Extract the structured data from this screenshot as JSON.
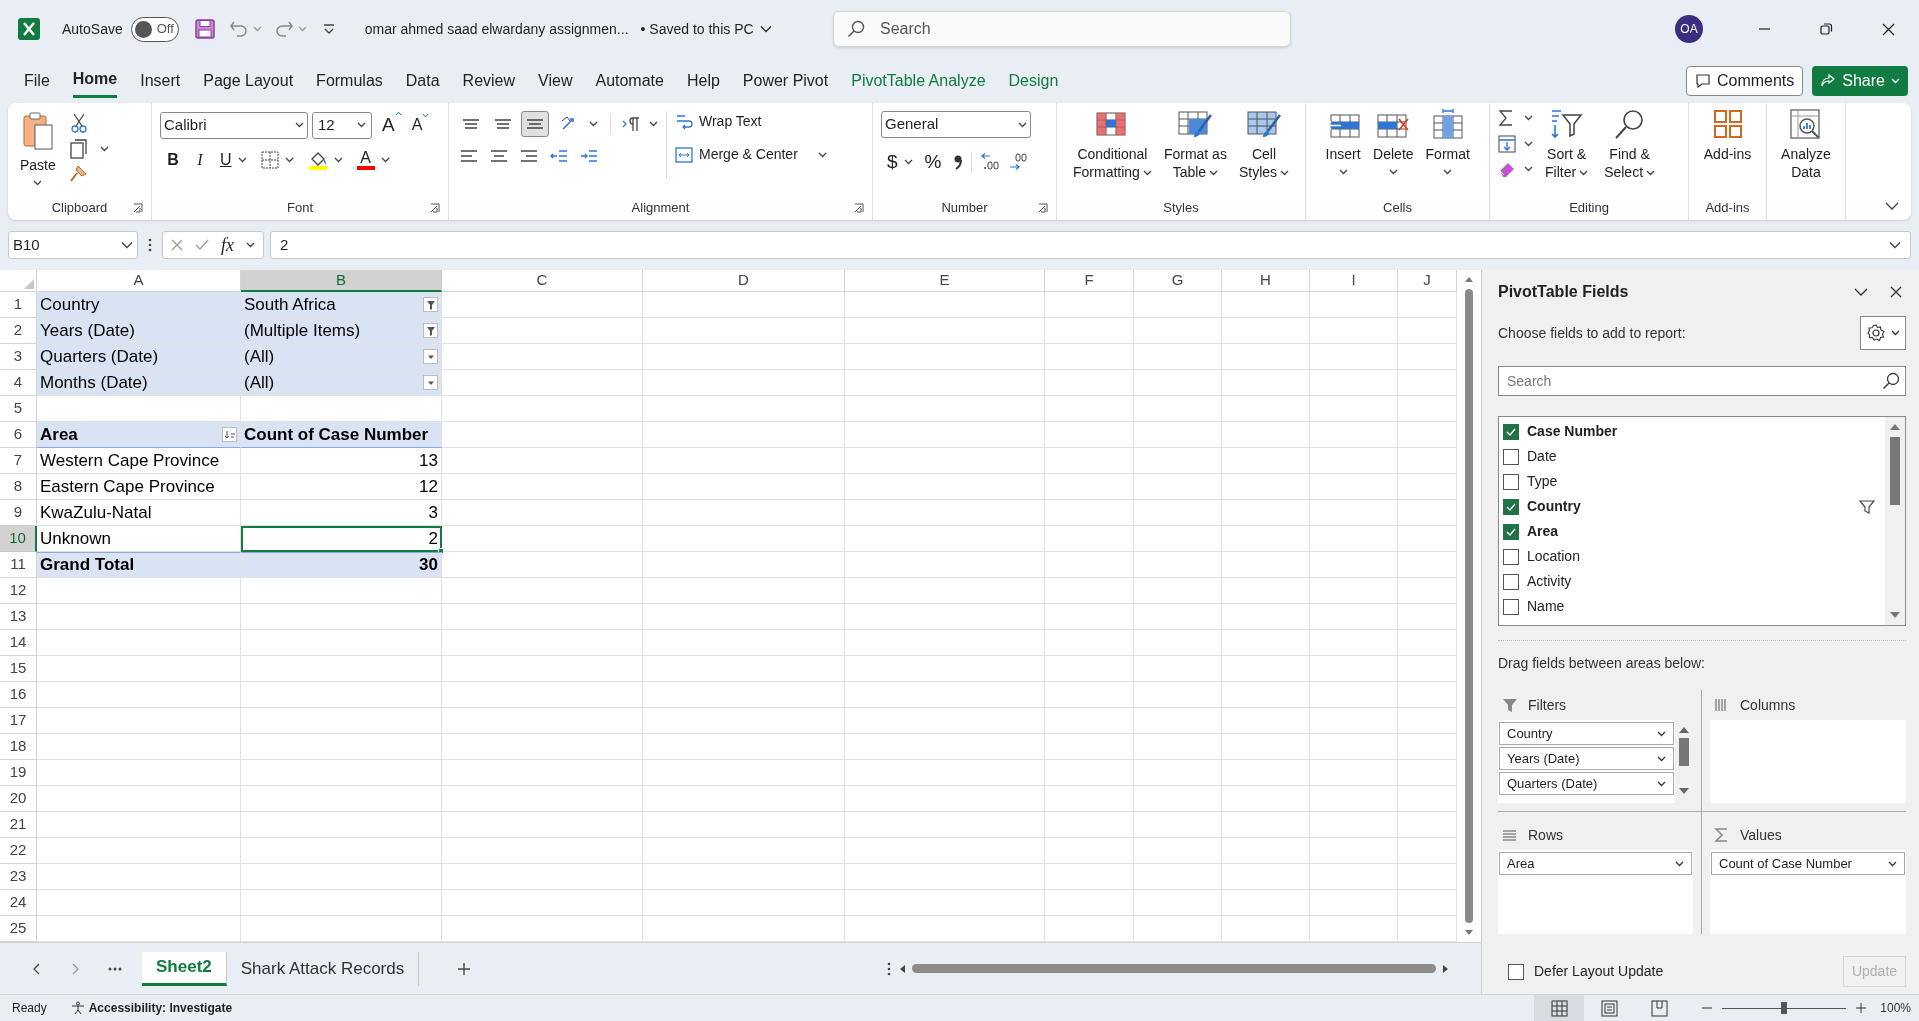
{
  "title_bar": {
    "autosave_label": "AutoSave",
    "autosave_on": false,
    "autosave_state": "Off",
    "document_title": "omar ahmed saad elwardany assignmen...",
    "save_status": "• Saved to this PC",
    "search_placeholder": "Search",
    "avatar": "OA"
  },
  "ribbon_tabs": [
    {
      "label": "File",
      "selected": false,
      "contextual": false
    },
    {
      "label": "Home",
      "selected": true,
      "contextual": false
    },
    {
      "label": "Insert",
      "selected": false,
      "contextual": false
    },
    {
      "label": "Page Layout",
      "selected": false,
      "contextual": false
    },
    {
      "label": "Formulas",
      "selected": false,
      "contextual": false
    },
    {
      "label": "Data",
      "selected": false,
      "contextual": false
    },
    {
      "label": "Review",
      "selected": false,
      "contextual": false
    },
    {
      "label": "View",
      "selected": false,
      "contextual": false
    },
    {
      "label": "Automate",
      "selected": false,
      "contextual": false
    },
    {
      "label": "Help",
      "selected": false,
      "contextual": false
    },
    {
      "label": "Power Pivot",
      "selected": false,
      "contextual": false
    },
    {
      "label": "PivotTable Analyze",
      "selected": false,
      "contextual": true
    },
    {
      "label": "Design",
      "selected": false,
      "contextual": true
    }
  ],
  "comments_button": "Comments",
  "share_button": "Share",
  "ribbon_groups": [
    {
      "kind": "clipboard",
      "label": "Clipboard",
      "launcher": true,
      "paste": "Paste"
    },
    {
      "kind": "font",
      "label": "Font",
      "launcher": true,
      "font_name": "Calibri",
      "font_size": "12",
      "grow_font": "A",
      "shrink_font": "A",
      "bold": "B",
      "italic": "I",
      "underline": "U",
      "font_color": "A"
    },
    {
      "kind": "alignment",
      "label": "Alignment",
      "launcher": true,
      "vertical_align": [
        {
          "selected": false
        },
        {
          "selected": false
        },
        {
          "selected": true
        }
      ],
      "wrap": "Wrap Text",
      "merge": "Merge & Center"
    },
    {
      "kind": "number",
      "label": "Number",
      "launcher": true,
      "format": "General",
      "currency": "$",
      "percent": "%"
    },
    {
      "kind": "styles",
      "label": "Styles",
      "launcher": false,
      "buttons": [
        {
          "kind": "conditional",
          "lines": [
            "Conditional",
            "Formatting"
          ],
          "dropdown": true
        },
        {
          "kind": "tablestyle",
          "lines": [
            "Format as",
            "Table"
          ],
          "dropdown": true
        },
        {
          "kind": "cellstyles",
          "lines": [
            "Cell",
            "Styles"
          ],
          "dropdown": true
        }
      ]
    },
    {
      "kind": "cells",
      "label": "Cells",
      "launcher": false,
      "buttons": [
        {
          "kind": "insert",
          "lines": [
            "Insert"
          ],
          "dropdown": true
        },
        {
          "kind": "delete",
          "lines": [
            "Delete"
          ],
          "dropdown": true
        },
        {
          "kind": "format",
          "lines": [
            "Format"
          ],
          "dropdown": true
        }
      ]
    },
    {
      "kind": "editing",
      "label": "Editing",
      "launcher": false,
      "buttons": [
        {
          "kind": "sort",
          "lines": [
            "Sort &",
            "Filter"
          ],
          "dropdown": true
        },
        {
          "kind": "find",
          "lines": [
            "Find &",
            "Select"
          ],
          "dropdown": true
        }
      ]
    },
    {
      "kind": "addins",
      "label": "Add-ins",
      "launcher": false,
      "buttons": [
        {
          "kind": "addins",
          "lines": [
            "Add-ins"
          ],
          "dropdown": false
        }
      ]
    },
    {
      "kind": "analyze",
      "launcher": false,
      "buttons": [
        {
          "kind": "analyze",
          "lines": [
            "Analyze",
            "Data"
          ],
          "dropdown": false
        }
      ]
    }
  ],
  "formula_bar": {
    "name_box": "B10",
    "function_label": "fx",
    "formula": "2"
  },
  "columns": [
    {
      "label": "A",
      "selected": false
    },
    {
      "label": "B",
      "selected": true
    },
    {
      "label": "C",
      "selected": false
    },
    {
      "label": "D",
      "selected": false
    },
    {
      "label": "E",
      "selected": false
    },
    {
      "label": "F",
      "selected": false
    },
    {
      "label": "G",
      "selected": false
    },
    {
      "label": "H",
      "selected": false
    },
    {
      "label": "I",
      "selected": false
    },
    {
      "label": "J",
      "selected": false
    }
  ],
  "rows": [
    {
      "number": "1",
      "selected": false,
      "cells": [
        {
          "text": "Country",
          "kind": "field",
          "selected": false
        },
        {
          "text": "South Africa",
          "kind": "field",
          "button": {
            "kind": "funnel"
          },
          "selected": false
        }
      ]
    },
    {
      "number": "2",
      "selected": false,
      "cells": [
        {
          "text": "Years (Date)",
          "kind": "field",
          "selected": false
        },
        {
          "text": "(Multiple Items)",
          "kind": "field",
          "button": {
            "kind": "funnel"
          },
          "selected": false
        }
      ]
    },
    {
      "number": "3",
      "selected": false,
      "cells": [
        {
          "text": "Quarters (Date)",
          "kind": "field",
          "selected": false
        },
        {
          "text": "(All)",
          "kind": "field",
          "button": {
            "kind": "dropdown"
          },
          "selected": false
        }
      ]
    },
    {
      "number": "4",
      "selected": false,
      "cells": [
        {
          "text": "Months (Date)",
          "kind": "field",
          "selected": false
        },
        {
          "text": "(All)",
          "kind": "field",
          "button": {
            "kind": "dropdown"
          },
          "selected": false
        }
      ]
    },
    {
      "number": "5",
      "selected": false
    },
    {
      "number": "6",
      "selected": false,
      "cells": [
        {
          "text": "Area",
          "kind": "header",
          "button": {
            "kind": "sort"
          },
          "selected": false
        },
        {
          "text": "Count of Case Number",
          "kind": "header",
          "selected": false
        }
      ]
    },
    {
      "number": "7",
      "selected": false,
      "cells": [
        {
          "text": "Western Cape Province",
          "kind": "item",
          "selected": false
        },
        {
          "text": "13",
          "kind": "value",
          "selected": false
        }
      ]
    },
    {
      "number": "8",
      "selected": false,
      "cells": [
        {
          "text": "Eastern Cape Province",
          "kind": "item",
          "selected": false
        },
        {
          "text": "12",
          "kind": "value",
          "selected": false
        }
      ]
    },
    {
      "number": "9",
      "selected": false,
      "cells": [
        {
          "text": "KwaZulu-Natal",
          "kind": "item",
          "selected": false
        },
        {
          "text": "3",
          "kind": "value",
          "selected": false
        }
      ]
    },
    {
      "number": "10",
      "selected": true,
      "cells": [
        {
          "text": "Unknown",
          "kind": "item",
          "selected": false
        },
        {
          "text": "2",
          "kind": "value",
          "selected": true
        }
      ]
    },
    {
      "number": "11",
      "selected": false,
      "cells": [
        {
          "text": "Grand Total",
          "kind": "total",
          "selected": false
        },
        {
          "text": "30",
          "kind": "totalvalue",
          "selected": false
        }
      ]
    },
    {
      "number": "12",
      "selected": false
    },
    {
      "number": "13",
      "selected": false
    },
    {
      "number": "14",
      "selected": false
    },
    {
      "number": "15",
      "selected": false
    },
    {
      "number": "16",
      "selected": false
    },
    {
      "number": "17",
      "selected": false
    },
    {
      "number": "18",
      "selected": false
    },
    {
      "number": "19",
      "selected": false
    },
    {
      "number": "20",
      "selected": false
    },
    {
      "number": "21",
      "selected": false
    },
    {
      "number": "22",
      "selected": false
    },
    {
      "number": "23",
      "selected": false
    },
    {
      "number": "24",
      "selected": false
    },
    {
      "number": "25",
      "selected": false
    }
  ],
  "sheet_tabs": [
    {
      "label": "Sheet2",
      "selected": true
    },
    {
      "label": "Shark Attack Records",
      "selected": false
    }
  ],
  "status_bar": {
    "status": "Ready",
    "accessibility": "Accessibility: Investigate",
    "views": [
      {
        "selected": true
      },
      {
        "selected": false
      },
      {
        "selected": false
      }
    ],
    "zoom_slider": {
      "level": 0.5
    },
    "zoom": "100%"
  },
  "pivot_panel": {
    "title": "PivotTable Fields",
    "subtitle": "Choose fields to add to report:",
    "search_placeholder": "Search",
    "fields": [
      {
        "label": "Case Number",
        "checked": true,
        "filtered": false
      },
      {
        "label": "Date",
        "checked": false,
        "filtered": false
      },
      {
        "label": "Type",
        "checked": false,
        "filtered": false
      },
      {
        "label": "Country",
        "checked": true,
        "filtered": true
      },
      {
        "label": "Area",
        "checked": true,
        "filtered": false
      },
      {
        "label": "Location",
        "checked": false,
        "filtered": false
      },
      {
        "label": "Activity",
        "checked": false,
        "filtered": false
      },
      {
        "label": "Name",
        "checked": false,
        "filtered": false
      }
    ],
    "drag_hint": "Drag fields between areas below:",
    "areas": [
      {
        "kind": "filters",
        "label": "Filters",
        "items": [
          "Country",
          "Years (Date)",
          "Quarters (Date)"
        ]
      },
      {
        "kind": "columns",
        "label": "Columns"
      },
      {
        "kind": "rows",
        "label": "Rows",
        "items": [
          "Area"
        ]
      },
      {
        "kind": "values",
        "label": "Values",
        "items": [
          "Count of Case Number"
        ]
      }
    ],
    "defer": {
      "label": "Defer Layout Update",
      "checked": false
    },
    "update_button": {
      "label": "Update",
      "disabled": true
    }
  }
}
